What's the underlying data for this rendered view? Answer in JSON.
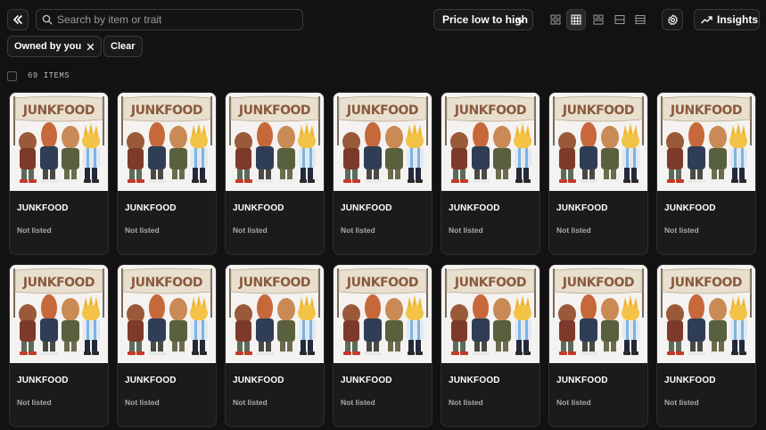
{
  "toolbar": {
    "search_placeholder": "Search by item or trait",
    "sort_label": "Price low to high",
    "insights_label": "Insights"
  },
  "filters": {
    "chips": [
      {
        "label": "Owned by you"
      },
      {
        "label": "Clear"
      }
    ]
  },
  "results": {
    "count_label": "69 ITEMS"
  },
  "items": [
    {
      "title": "JUNKFOOD",
      "status": "Not listed",
      "banner": "JUNKFOOD"
    },
    {
      "title": "JUNKFOOD",
      "status": "Not listed",
      "banner": "JUNKFOOD"
    },
    {
      "title": "JUNKFOOD",
      "status": "Not listed",
      "banner": "JUNKFOOD"
    },
    {
      "title": "JUNKFOOD",
      "status": "Not listed",
      "banner": "JUNKFOOD"
    },
    {
      "title": "JUNKFOOD",
      "status": "Not listed",
      "banner": "JUNKFOOD"
    },
    {
      "title": "JUNKFOOD",
      "status": "Not listed",
      "banner": "JUNKFOOD"
    },
    {
      "title": "JUNKFOOD",
      "status": "Not listed",
      "banner": "JUNKFOOD"
    },
    {
      "title": "JUNKFOOD",
      "status": "Not listed",
      "banner": "JUNKFOOD"
    },
    {
      "title": "JUNKFOOD",
      "status": "Not listed",
      "banner": "JUNKFOOD"
    },
    {
      "title": "JUNKFOOD",
      "status": "Not listed",
      "banner": "JUNKFOOD"
    },
    {
      "title": "JUNKFOOD",
      "status": "Not listed",
      "banner": "JUNKFOOD"
    },
    {
      "title": "JUNKFOOD",
      "status": "Not listed",
      "banner": "JUNKFOOD"
    },
    {
      "title": "JUNKFOOD",
      "status": "Not listed",
      "banner": "JUNKFOOD"
    },
    {
      "title": "JUNKFOOD",
      "status": "Not listed",
      "banner": "JUNKFOOD"
    }
  ],
  "icons": {
    "collapse": "double-chevron-left-icon",
    "search": "search-icon",
    "sort_chevron": "chevron-down-icon",
    "views": [
      "grid-small-icon",
      "grid-medium-icon",
      "grid-large-icon",
      "list-icon",
      "table-icon"
    ],
    "settings": "gear-icon",
    "insights": "trend-line-icon",
    "chip_close": "close-icon"
  },
  "colors": {
    "background": "#121212",
    "card": "#1b1b1b",
    "border": "#3a3a3a",
    "text": "#ffffff",
    "muted": "#a8a8a8"
  }
}
